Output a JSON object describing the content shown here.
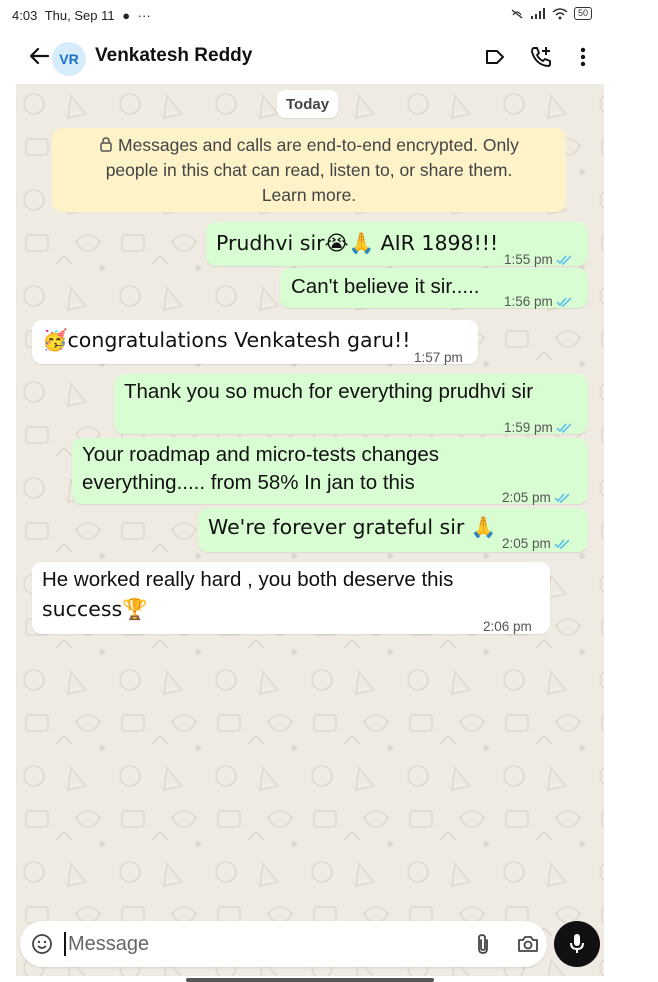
{
  "status_bar": {
    "time": "4:03",
    "date": "Thu, Sep 11",
    "overflow": "···",
    "battery": "50"
  },
  "header": {
    "avatar_initials": "VR",
    "contact_name": "Venkatesh Reddy"
  },
  "date_chip": "Today",
  "encryption_notice": {
    "line1": "Messages and calls are end-to-end encrypted. Only",
    "line2": "people in this chat can read, listen to, or share them.",
    "line3": "Learn more."
  },
  "messages": [
    {
      "direction": "out",
      "text": "Prudhvi sir😭🙏 AIR 1898!!!",
      "time": "1:55 pm",
      "read": true
    },
    {
      "direction": "out",
      "text": "Can't believe it sir.....",
      "time": "1:56 pm",
      "read": true
    },
    {
      "direction": "in",
      "text": "🥳congratulations Venkatesh garu!!",
      "time": "1:57 pm"
    },
    {
      "direction": "out",
      "text": "Thank you so much for everything prudhvi sir",
      "time": "1:59 pm",
      "read": true
    },
    {
      "direction": "out",
      "line1": "Your roadmap and micro-tests changes",
      "line2": "everything..... from 58% In jan to this",
      "time": "2:05 pm",
      "read": true
    },
    {
      "direction": "out",
      "text": "We're forever grateful sir 🙏",
      "time": "2:05 pm",
      "read": true
    },
    {
      "direction": "in",
      "line1": "He worked really hard , you both deserve this",
      "line2": "success🏆",
      "time": "2:06 pm"
    }
  ],
  "composer": {
    "placeholder": "Message"
  },
  "colors": {
    "outgoing_bubble": "#d9fdd3",
    "incoming_bubble": "#ffffff",
    "chat_background": "#efeae2",
    "read_ticks": "#53bdeb",
    "encryption_notice_bg": "#fdf2c8",
    "avatar_bg": "#d7ecfb"
  },
  "icons": [
    "arrow-left-icon",
    "label-icon",
    "add-call-icon",
    "more-vert-icon",
    "lock-icon",
    "emoji-icon",
    "attach-icon",
    "camera-icon",
    "mic-icon",
    "double-tick-icon"
  ]
}
